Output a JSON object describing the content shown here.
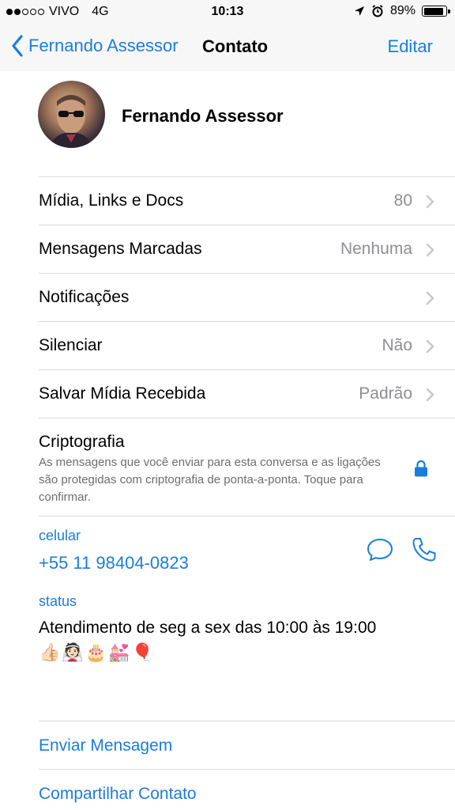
{
  "status_bar": {
    "carrier": "VIVO",
    "network": "4G",
    "time": "10:13",
    "battery": "89%",
    "battery_level": 0.89,
    "signal_icon": "signal-dots-icon",
    "location_icon": "location-arrow-icon",
    "alarm_icon": "alarm-clock-icon"
  },
  "nav": {
    "back_label": "Fernando Assessor",
    "title": "Contato",
    "edit_label": "Editar"
  },
  "profile": {
    "name": "Fernando Assessor"
  },
  "rows": [
    {
      "label": "Mídia, Links e Docs",
      "value": "80"
    },
    {
      "label": "Mensagens Marcadas",
      "value": "Nenhuma"
    },
    {
      "label": "Notificações",
      "value": ""
    },
    {
      "label": "Silenciar",
      "value": "Não"
    },
    {
      "label": "Salvar Mídia Recebida",
      "value": "Padrão"
    }
  ],
  "crypto": {
    "title": "Criptografia",
    "description": "As mensagens que você enviar para esta conversa e as ligações são protegidas com criptografia de ponta-a-ponta. Toque para confirmar."
  },
  "phone": {
    "label": "celular",
    "number": "+55 11 98404-0823"
  },
  "status": {
    "label": "status",
    "text": "Atendimento de seg a sex das 10:00 às 19:00",
    "emojis": "👍🏻👰🏻🎂💒🎈"
  },
  "actions": {
    "send_message": "Enviar Mensagem",
    "share_contact": "Compartilhar Contato"
  },
  "colors": {
    "accent": "#1a7ddc",
    "secondary_text": "#8e8e93",
    "separator": "#dcdcdc",
    "bar_background": "#f7f7f7"
  }
}
